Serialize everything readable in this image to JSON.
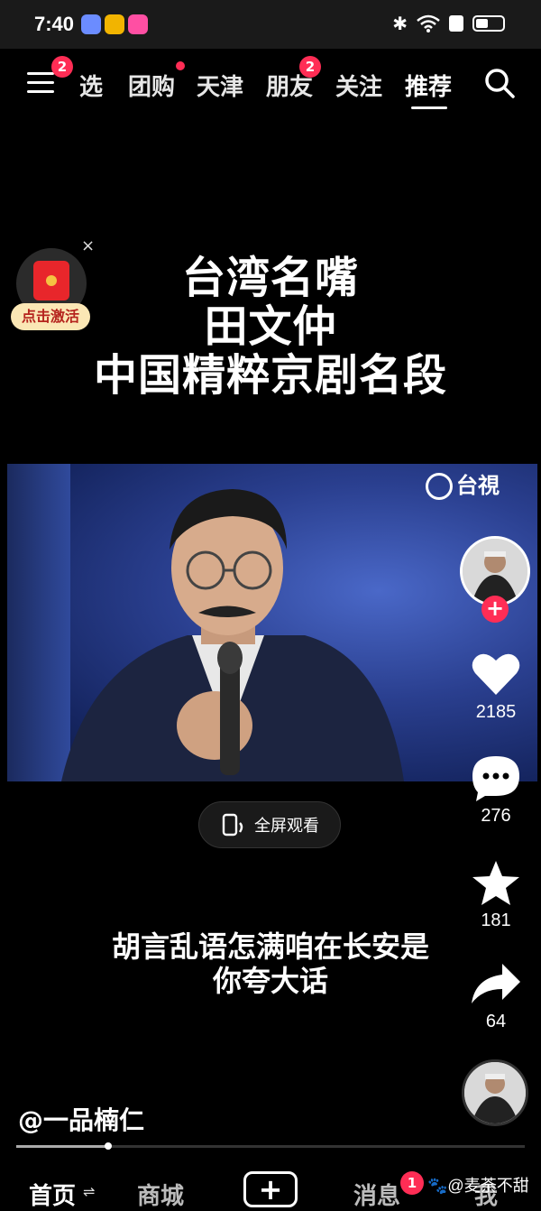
{
  "status_bar": {
    "time": "7:40",
    "battery_level": 0.45
  },
  "top_nav": {
    "menu_badge": "2",
    "tabs": [
      {
        "label": "选"
      },
      {
        "label": "团购"
      },
      {
        "label": "天津"
      },
      {
        "label": "朋友",
        "badge": "2"
      },
      {
        "label": "关注"
      },
      {
        "label": "推荐",
        "active": true
      }
    ]
  },
  "red_packet": {
    "label": "点击激活",
    "close": "×"
  },
  "overlay_title": [
    "台湾名嘴",
    "田文仲",
    "中国精粹京剧名段"
  ],
  "video": {
    "channel_logo": "台視"
  },
  "fullscreen": {
    "label": "全屏观看"
  },
  "subtitle": [
    "胡言乱语怎满咱在长安是",
    "你夸大话"
  ],
  "right_rail": {
    "follow": "+",
    "likes": "2185",
    "comments": "276",
    "favorites": "181",
    "shares": "64"
  },
  "author": "@一品楠仁",
  "playback_progress": 0.18,
  "bottom_nav": {
    "items": [
      {
        "label": "首页"
      },
      {
        "label": "商城"
      },
      {
        "label": "+"
      },
      {
        "label": "消息",
        "badge": "1"
      },
      {
        "label": "我"
      }
    ]
  },
  "watermark": "@麦荼不甜"
}
